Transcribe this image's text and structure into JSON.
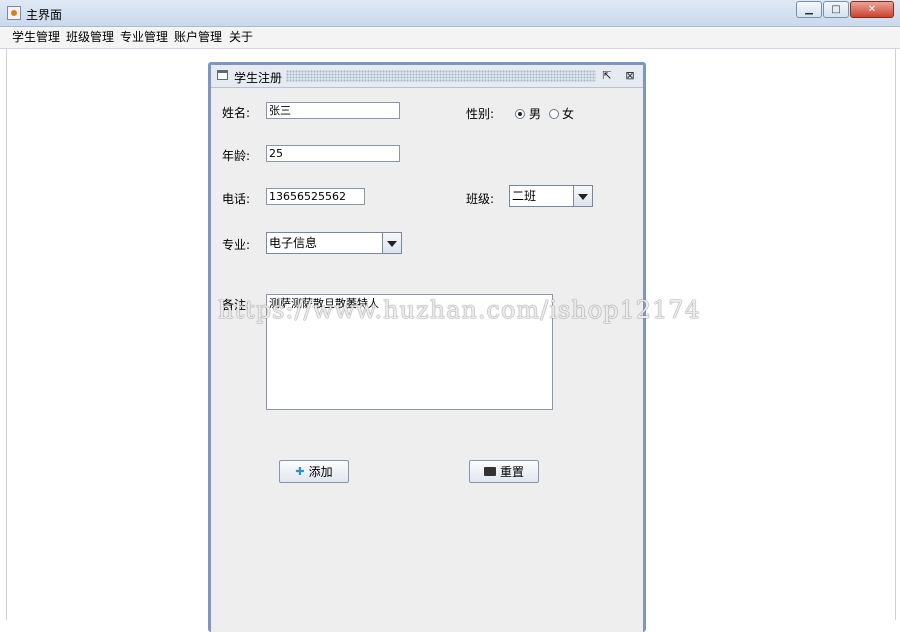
{
  "window": {
    "title": "主界面"
  },
  "menubar": {
    "items": [
      "学生管理",
      "班级管理",
      "专业管理",
      "账户管理",
      "关于"
    ]
  },
  "internal_frame": {
    "title": "学生注册",
    "restore_glyph": "⇱",
    "close_glyph": "⊠"
  },
  "form": {
    "name_label": "姓名:",
    "name_value": "张三",
    "gender_label": "性别:",
    "gender_male": "男",
    "gender_female": "女",
    "gender_selected": "男",
    "age_label": "年龄:",
    "age_value": "25",
    "phone_label": "电话:",
    "phone_value": "13656525562",
    "class_label": "班级:",
    "class_value": "二班",
    "major_label": "专业:",
    "major_value": "电子信息",
    "remark_label": "备注:",
    "remark_value": "测萨测萨散旦散萎特人"
  },
  "buttons": {
    "add_label": "添加",
    "reset_label": "重置"
  },
  "watermark": "https://www.huzhan.com/ishop12174"
}
